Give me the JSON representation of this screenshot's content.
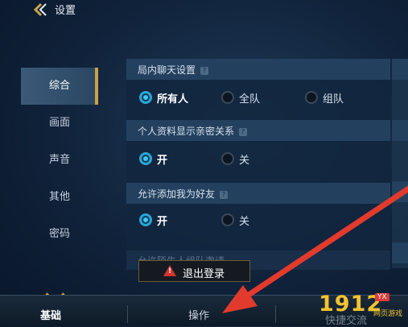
{
  "header": {
    "title": "设置"
  },
  "sidebar": {
    "items": [
      {
        "label": "综合",
        "active": true
      },
      {
        "label": "画面"
      },
      {
        "label": "声音"
      },
      {
        "label": "其他"
      },
      {
        "label": "密码"
      }
    ]
  },
  "sections": [
    {
      "title": "局内聊天设置",
      "options": [
        "所有人",
        "全队",
        "组队"
      ],
      "selected": "所有人"
    },
    {
      "title": "个人资料显示亲密关系",
      "options": [
        "开",
        "关"
      ],
      "selected": "开"
    },
    {
      "title": "允许添加我为好友",
      "options": [
        "开",
        "关"
      ],
      "selected": "开"
    },
    {
      "title": "允许陌生人组队邀请"
    }
  ],
  "logout": {
    "label": "退出登录"
  },
  "bottom_tabs": [
    "基础",
    "操作",
    "快捷交流"
  ],
  "watermark": {
    "main": "1912",
    "tag": "YX",
    "sub": "网页游戏"
  },
  "colors": {
    "accent": "#c9a24a",
    "radio_on": "#2aa6d8",
    "arrow": "#e23a2c",
    "warn": "#d0342c"
  }
}
